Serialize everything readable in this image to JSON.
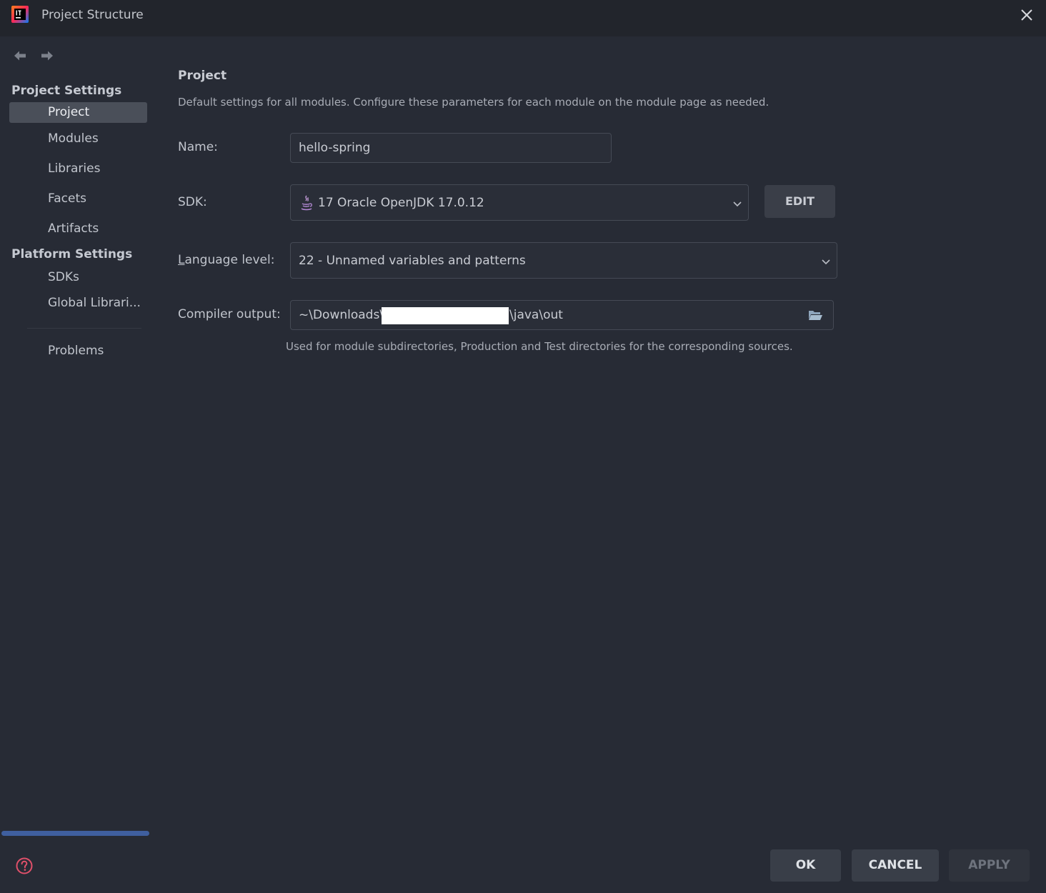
{
  "window": {
    "title": "Project Structure"
  },
  "icons": {
    "app_logo": "intellij-idea-icon",
    "close": "close-icon",
    "back": "arrow-left-icon",
    "forward": "arrow-right-icon",
    "sdk": "java-coffee-cup-icon",
    "dropdown": "chevron-down-icon",
    "browse": "folder-open-icon",
    "help": "help-question-icon"
  },
  "sidebar": {
    "project_settings_header": "Project Settings",
    "project_settings_items": [
      {
        "label": "Project",
        "selected": true
      },
      {
        "label": "Modules",
        "selected": false
      },
      {
        "label": "Libraries",
        "selected": false
      },
      {
        "label": "Facets",
        "selected": false
      },
      {
        "label": "Artifacts",
        "selected": false
      }
    ],
    "platform_settings_header": "Platform Settings",
    "platform_settings_items": [
      {
        "label": "SDKs",
        "selected": false
      },
      {
        "label": "Global Librari..."
      }
    ],
    "problems_label": "Problems"
  },
  "main": {
    "title": "Project",
    "description": "Default settings for all modules. Configure these parameters for each module on the module page as needed.",
    "name": {
      "label": "Name:",
      "value": "hello-spring"
    },
    "sdk": {
      "label": "SDK:",
      "value": "17 Oracle OpenJDK 17.0.12",
      "edit_label": "EDIT"
    },
    "language_level": {
      "label_mnemonic": "L",
      "label_rest": "anguage level:",
      "value": "22 - Unnamed variables and patterns"
    },
    "compiler_output": {
      "label": "Compiler output:",
      "value_prefix": "~\\Downloads\\",
      "value_suffix": "\\java\\out",
      "hint": "Used for module subdirectories, Production and Test directories for the corresponding sources."
    }
  },
  "footer": {
    "ok_label": "OK",
    "cancel_label": "CANCEL",
    "apply_label": "APPLY"
  },
  "colors": {
    "background": "#272b35",
    "titlebar": "#22252c",
    "selection": "#4a4f59",
    "accent_scrollbar": "#3f5f9f",
    "help_icon": "#e0506a"
  }
}
